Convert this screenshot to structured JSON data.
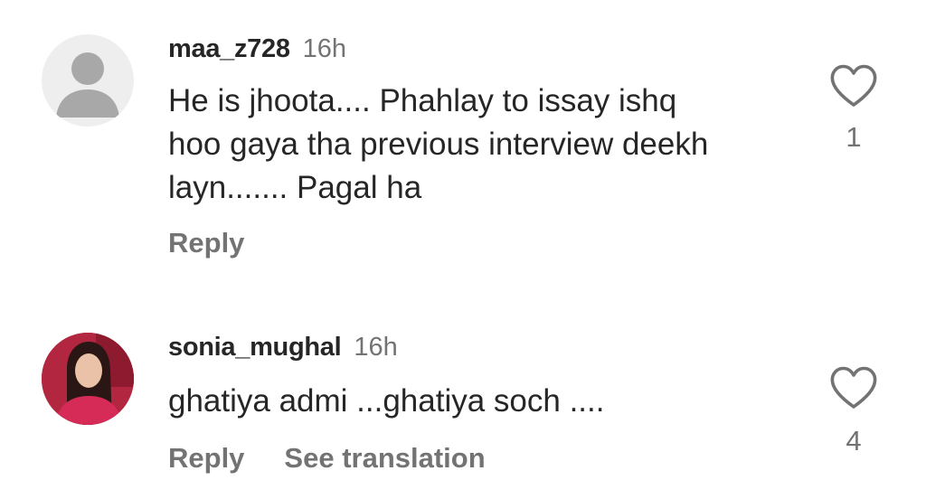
{
  "comments": [
    {
      "username": "maa_z728",
      "time": "16h",
      "text": "He is  jhoota.... Phahlay to issay ishq\nhoo gaya tha previous interview deekh\nlayn....... Pagal ha",
      "reply_label": "Reply",
      "likes": "1",
      "avatar": "default-user-icon"
    },
    {
      "username": "sonia_mughal",
      "time": "16h",
      "text": "ghatiya admi ...ghatiya soch ....",
      "reply_label": "Reply",
      "see_translation_label": "See translation",
      "likes": "4",
      "avatar": "profile-photo"
    }
  ],
  "colors": {
    "primary_text": "#262626",
    "secondary_text": "#737373",
    "default_avatar_bg": "#eeeeee",
    "default_avatar_fg": "#a8a8a8"
  }
}
